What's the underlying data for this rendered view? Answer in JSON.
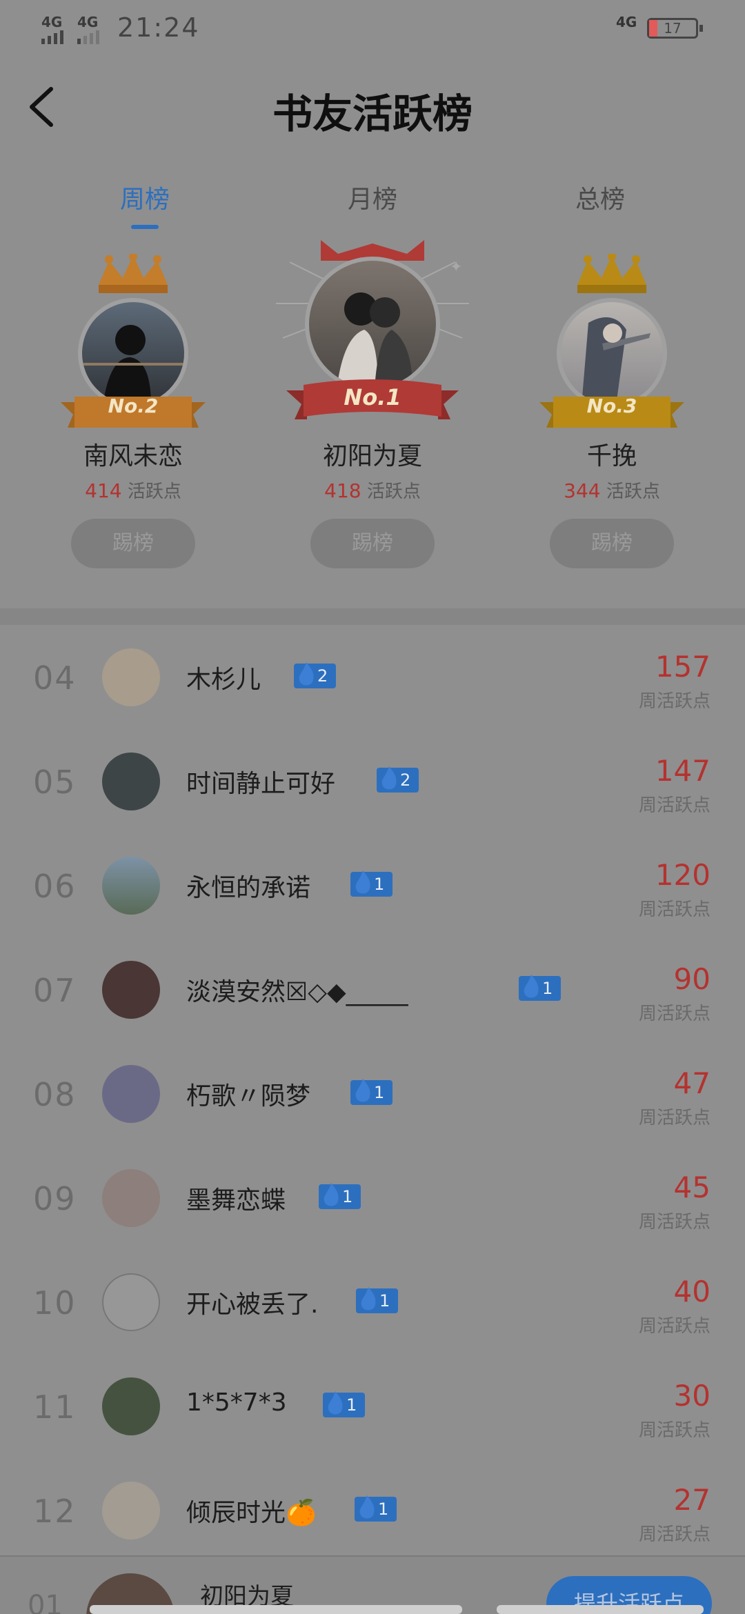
{
  "status_bar": {
    "left_net1": "4G",
    "left_net2": "4G",
    "time": "21:24",
    "right_net": "4G",
    "battery": "17"
  },
  "header": {
    "title": "书友活跃榜"
  },
  "tabs": [
    {
      "label": "周榜",
      "active": true
    },
    {
      "label": "月榜",
      "active": false
    },
    {
      "label": "总榜",
      "active": false
    }
  ],
  "podium": {
    "points_label": "活跃点",
    "kick_label": "踢榜",
    "first": {
      "rank_label": "No.1",
      "name": "初阳为夏",
      "points": "418"
    },
    "second": {
      "rank_label": "No.2",
      "name": "南风未恋",
      "points": "414"
    },
    "third": {
      "rank_label": "No.3",
      "name": "千挽",
      "points": "344"
    }
  },
  "list_points_label": "周活跃点",
  "list": [
    {
      "rank": "04",
      "name": "木杉儿",
      "badge": "2",
      "points": "157"
    },
    {
      "rank": "05",
      "name": "时间静止可好",
      "badge": "2",
      "points": "147"
    },
    {
      "rank": "06",
      "name": "永恒的承诺",
      "badge": "1",
      "points": "120"
    },
    {
      "rank": "07",
      "name": "淡漠安然☒◇◆_____",
      "badge": "1",
      "points": "90"
    },
    {
      "rank": "08",
      "name": "朽歌〃陨梦",
      "badge": "1",
      "points": "47"
    },
    {
      "rank": "09",
      "name": "墨舞恋蝶",
      "badge": "1",
      "points": "45"
    },
    {
      "rank": "10",
      "name": "开心被丢了.",
      "badge": "1",
      "points": "40"
    },
    {
      "rank": "11",
      "name": "1*5*7*3",
      "badge": "1",
      "points": "30"
    },
    {
      "rank": "12",
      "name": "倾辰时光🍊",
      "badge": "1",
      "points": "27"
    }
  ],
  "bottom": {
    "rank": "01",
    "name": "初阳为夏",
    "boost_label": "提升活跃点"
  },
  "colors": {
    "accent": "#2c6fbf",
    "points_red": "#b4322f",
    "overlay_bg": "#8f8f8f"
  }
}
